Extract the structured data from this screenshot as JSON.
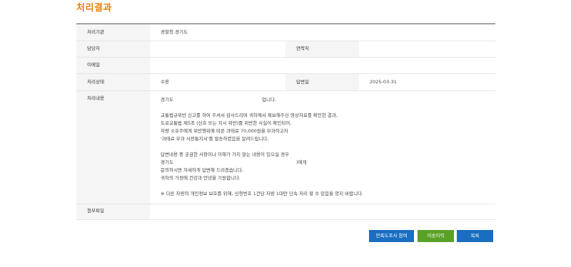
{
  "title": "처리결과",
  "table": {
    "agency_label": "처리기관",
    "agency_value": "경찰청 경기도",
    "manager_label": "담당자",
    "manager_value": "",
    "contact_label": "연락처",
    "contact_value": "",
    "email_label": "이메일",
    "email_value": "",
    "status_label": "처리상태",
    "status_value": "수용",
    "answer_date_label": "답변일",
    "answer_date_value": "2025-03-31",
    "content_label": "처리내용",
    "attachment_label": "첨부파일",
    "attachment_value": ""
  },
  "content": {
    "greeting_a": "경기도",
    "greeting_b": "입니다.",
    "line1": "교통법규위반 신고를 하여 주셔서 감사드리며 귀하께서 제보해주신 영상자료를 확인한 결과,",
    "line2": "도로교통법 제5조 (신호 또는 지시 위반)를 위반한 사실이 확인되어,",
    "line3": "차량 소유주에게 위반행위에 따른 과태료 70,000원을 부과하고자",
    "line4": "'과태료 부과 사전통지서'를 발송하였음을 알려드립니다.",
    "line5": "답변내용 중 궁금한 사항이나 이해가 가지 않는 내용이 있으실 경우",
    "line6_a": "경기도",
    "line6_b": ")에게",
    "line7": "문의하시면 자세하게 답변해 드리겠습니다.",
    "line8": "귀하의 가정에 건강과 안녕을 기원합니다.",
    "notice": "※ 다른 차량의 개인정보 보호를 위해, 신청번호 1건당 차량 1대만 단속 처리 할 수 있음을 양지 바랍니다."
  },
  "buttons": {
    "survey": "만족도조사 참여",
    "transfer_history": "이송이력",
    "list": "목록"
  },
  "colors": {
    "title": "#f07c00",
    "button_blue": "#1a6ec0",
    "button_green": "#5aa128"
  }
}
